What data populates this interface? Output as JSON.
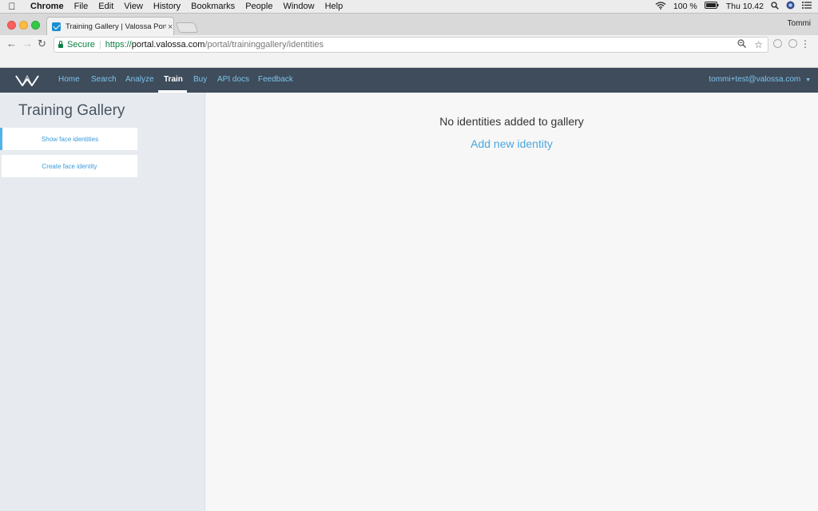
{
  "os_menubar": {
    "app_name": "Chrome",
    "items": [
      "File",
      "Edit",
      "View",
      "History",
      "Bookmarks",
      "People",
      "Window",
      "Help"
    ],
    "battery": "100 %",
    "clock": "Thu 10.42"
  },
  "browser": {
    "tab_title": "Training Gallery | Valossa Portal",
    "tab_close": "×",
    "profile_name": "Tommi",
    "secure_label": "Secure",
    "url_scheme": "https://",
    "url_host": "portal.valossa.com",
    "url_path": "/portal/traininggallery/identities"
  },
  "app_nav": {
    "links": [
      "Home",
      "Search",
      "Analyze",
      "Train",
      "Buy",
      "API docs",
      "Feedback"
    ],
    "active": "Train",
    "user_email": "tommi+test@valossa.com"
  },
  "sidebar": {
    "title": "Training Gallery",
    "items": [
      "Show face identities",
      "Create face identity"
    ]
  },
  "main": {
    "empty_message": "No identities added to gallery",
    "add_link": "Add new identity"
  }
}
